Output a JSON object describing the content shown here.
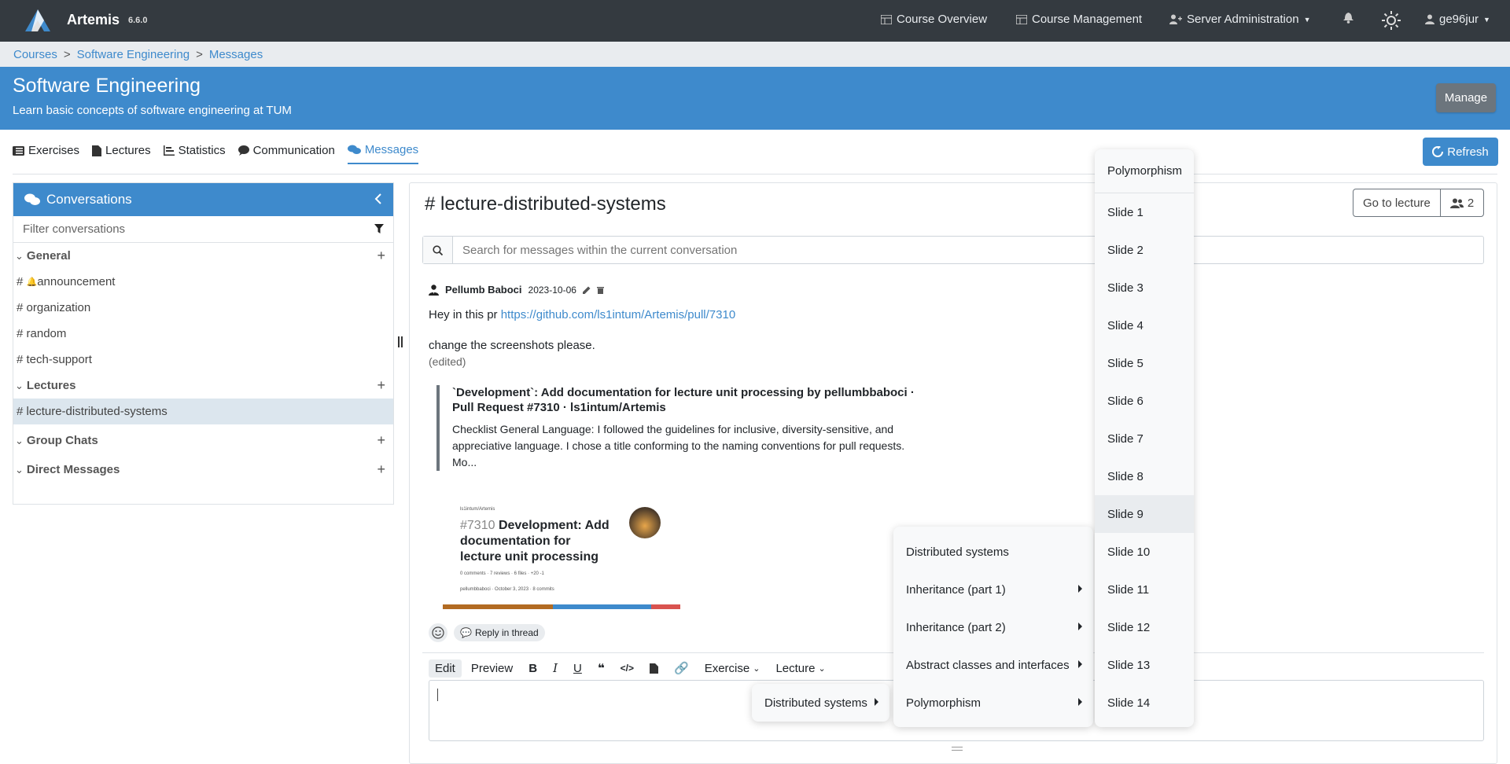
{
  "app": {
    "brand": "Artemis",
    "version": "6.6.0"
  },
  "nav": {
    "course_overview": "Course Overview",
    "course_management": "Course Management",
    "server_administration": "Server Administration",
    "user": "ge96jur"
  },
  "breadcrumb": [
    "Courses",
    "Software Engineering",
    "Messages"
  ],
  "course": {
    "title": "Software Engineering",
    "subtitle": "Learn basic concepts of software engineering at TUM",
    "manage_label": "Manage"
  },
  "tabs": [
    "Exercises",
    "Lectures",
    "Statistics",
    "Communication",
    "Messages"
  ],
  "refresh_label": "Refresh",
  "sidebar": {
    "title": "Conversations",
    "filter_placeholder": "Filter conversations",
    "groups": {
      "general": "General",
      "lectures": "Lectures",
      "group_chats": "Group Chats",
      "direct_messages": "Direct Messages"
    },
    "general_channels": [
      "announcement",
      "organization",
      "random",
      "tech-support"
    ],
    "lecture_channels": [
      "lecture-distributed-systems"
    ]
  },
  "conversation": {
    "title": "# lecture-distributed-systems",
    "go_to_lecture": "Go to lecture",
    "member_count": "2",
    "search_placeholder": "Search for messages within the current conversation"
  },
  "post": {
    "author": "Pellumb Baboci",
    "date": "2023-10-06",
    "line1_prefix": "Hey in this pr ",
    "link": "https://github.com/ls1intum/Artemis/pull/7310",
    "line2": "change the screenshots please.",
    "edited": "(edited)",
    "preview_title": "`Development`: Add documentation for lecture unit processing by pellumbbaboci · Pull Request #7310 · ls1intum/Artemis",
    "preview_desc": "Checklist General Language: I followed the guidelines for inclusive, diversity-sensitive, and appreciative language. I chose a title conforming to the naming conventions for pull requests. Mo...",
    "og_repo": "ls1intum/Artemis",
    "og_number": "#7310",
    "og_title": "Development: Add documentation for lecture unit processing",
    "og_meta": "0 comments · 7 reviews · 6 files · +20 -1",
    "og_author": "pellumbbaboci · October 3, 2023 · 8 commits",
    "reply_label": "Reply in thread"
  },
  "editor": {
    "edit": "Edit",
    "preview": "Preview",
    "exercise": "Exercise",
    "lecture": "Lecture"
  },
  "menus": {
    "level1": [
      "Distributed systems"
    ],
    "level2": [
      "Distributed systems",
      "Inheritance (part 1)",
      "Inheritance (part 2)",
      "Abstract classes and interfaces",
      "Polymorphism"
    ],
    "level3_header": "Polymorphism",
    "level3": [
      "Slide 1",
      "Slide 2",
      "Slide 3",
      "Slide 4",
      "Slide 5",
      "Slide 6",
      "Slide 7",
      "Slide 8",
      "Slide 9",
      "Slide 10",
      "Slide 11",
      "Slide 12",
      "Slide 13",
      "Slide 14"
    ]
  },
  "colors": {
    "primary": "#3e8acc",
    "topbar": "#343a40",
    "secondary": "#6c757d"
  }
}
